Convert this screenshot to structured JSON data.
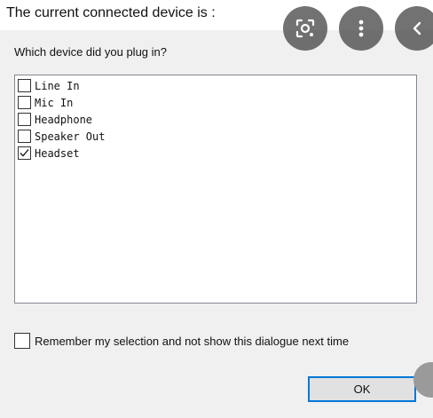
{
  "dialog": {
    "title": "The current connected device is :",
    "question": "Which device did you plug in?",
    "devices": [
      {
        "label": "Line In",
        "checked": false
      },
      {
        "label": "Mic In",
        "checked": false
      },
      {
        "label": "Headphone",
        "checked": false
      },
      {
        "label": "Speaker Out",
        "checked": false
      },
      {
        "label": "Headset",
        "checked": true
      }
    ],
    "remember_label": "Remember my selection and not show this dialogue next time",
    "remember_checked": false,
    "ok_label": "OK"
  },
  "overlay": {
    "buttons": [
      "lens-icon",
      "more-vert-icon",
      "chevron-left-icon"
    ]
  }
}
